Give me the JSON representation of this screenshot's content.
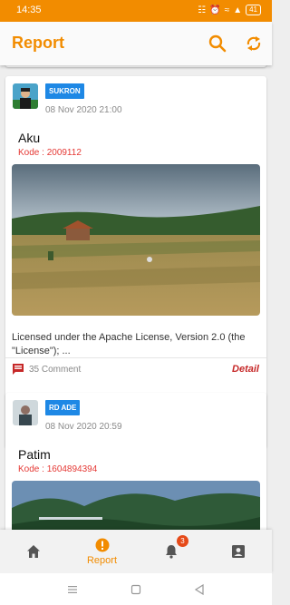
{
  "status_bar": {
    "time": "14:35",
    "battery": "41"
  },
  "app_bar": {
    "title": "Report",
    "icons": [
      "search-icon",
      "refresh-icon"
    ]
  },
  "posts": [
    {
      "username": "SUKRON",
      "date": "08 Nov 2020 21:00",
      "title": "Aku",
      "code": "Kode : 2009112",
      "description": "Licensed under the Apache License, Version 2.0 (the \"License\"); ...",
      "comments": "35 Comment",
      "detail_label": "Detail"
    },
    {
      "username": "RD ADE",
      "date": "08 Nov 2020 20:59",
      "title": "Patim",
      "code": "Kode : 1604894394"
    }
  ],
  "bottom_nav": {
    "items": [
      {
        "icon": "home-icon"
      },
      {
        "icon": "report-icon",
        "label": "Report",
        "active": true
      },
      {
        "icon": "bell-icon",
        "badge": "3"
      },
      {
        "icon": "account-box-icon"
      }
    ]
  },
  "colors": {
    "accent": "#f28c00",
    "badge_blue": "#1e88e5",
    "code_red": "#e53935",
    "detail_red": "#c62828"
  }
}
